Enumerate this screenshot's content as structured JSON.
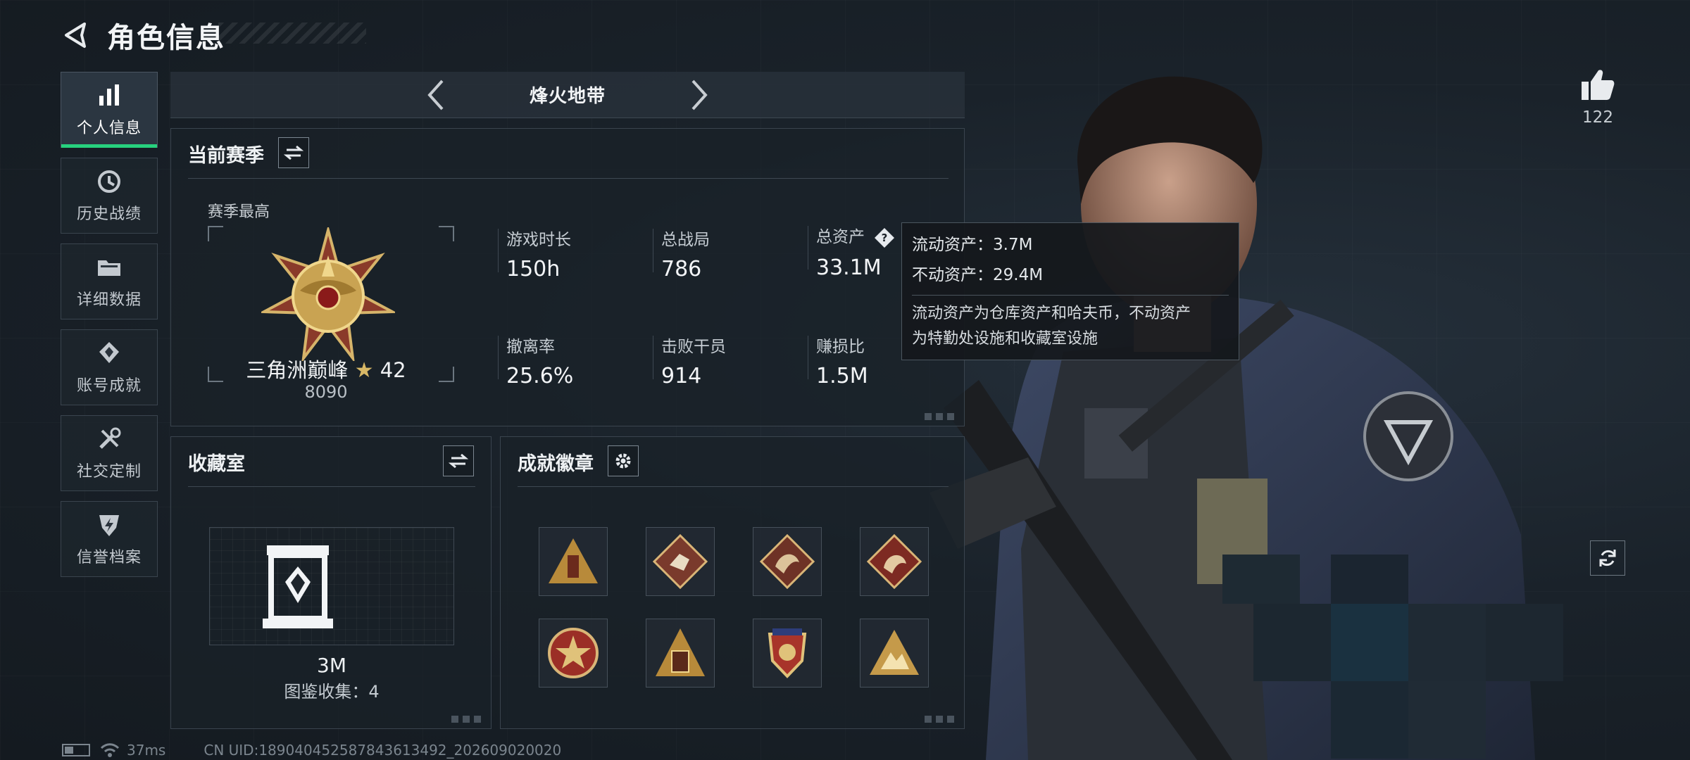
{
  "header": {
    "title": "角色信息"
  },
  "nav": {
    "items": [
      {
        "label": "个人信息",
        "active": true,
        "icon": "bar-chart-icon"
      },
      {
        "label": "历史战绩",
        "active": false,
        "icon": "history-icon"
      },
      {
        "label": "详细数据",
        "active": false,
        "icon": "folder-icon"
      },
      {
        "label": "账号成就",
        "active": false,
        "icon": "achievement-icon"
      },
      {
        "label": "社交定制",
        "active": false,
        "icon": "tools-icon"
      },
      {
        "label": "信誉档案",
        "active": false,
        "icon": "shield-icon"
      }
    ]
  },
  "mode": {
    "title": "烽火地带"
  },
  "season": {
    "title": "当前赛季",
    "high_label": "赛季最高",
    "rank_name": "三角洲巅峰",
    "rank_star_level": "42",
    "rank_score": "8090",
    "stats": [
      {
        "label": "游戏时长",
        "value": "150h"
      },
      {
        "label": "总战局",
        "value": "786"
      },
      {
        "label": "总资产",
        "value": "33.1M"
      },
      {
        "label": "撤离率",
        "value": "25.6%"
      },
      {
        "label": "击败干员",
        "value": "914"
      },
      {
        "label": "赚损比",
        "value": "1.5M"
      }
    ]
  },
  "tooltip": {
    "liquid": "流动资产：3.7M",
    "fixed": "不动资产：29.4M",
    "desc_line1": "流动资产为仓库资产和哈夫币，不动资产",
    "desc_line2": "为特勤处设施和收藏室设施"
  },
  "collection": {
    "title": "收藏室",
    "value": "3M",
    "catalog": "图鉴收集：4"
  },
  "achievements": {
    "title": "成就徽章",
    "badges": [
      "triangle-tower-badge",
      "diamond-runner-badge",
      "diamond-dragon-badge",
      "diamond-dragon-red-badge",
      "round-star-badge",
      "triangle-gate-badge",
      "shield-crest-badge",
      "triangle-mountain-badge"
    ]
  },
  "like": {
    "count": "122"
  },
  "footer": {
    "ping": "37ms",
    "uid": "CN UID:18904045258784361349​2_202609020020"
  },
  "colors": {
    "accent": "#27d27e",
    "gold": "#d8b866",
    "background": "#161d24"
  }
}
